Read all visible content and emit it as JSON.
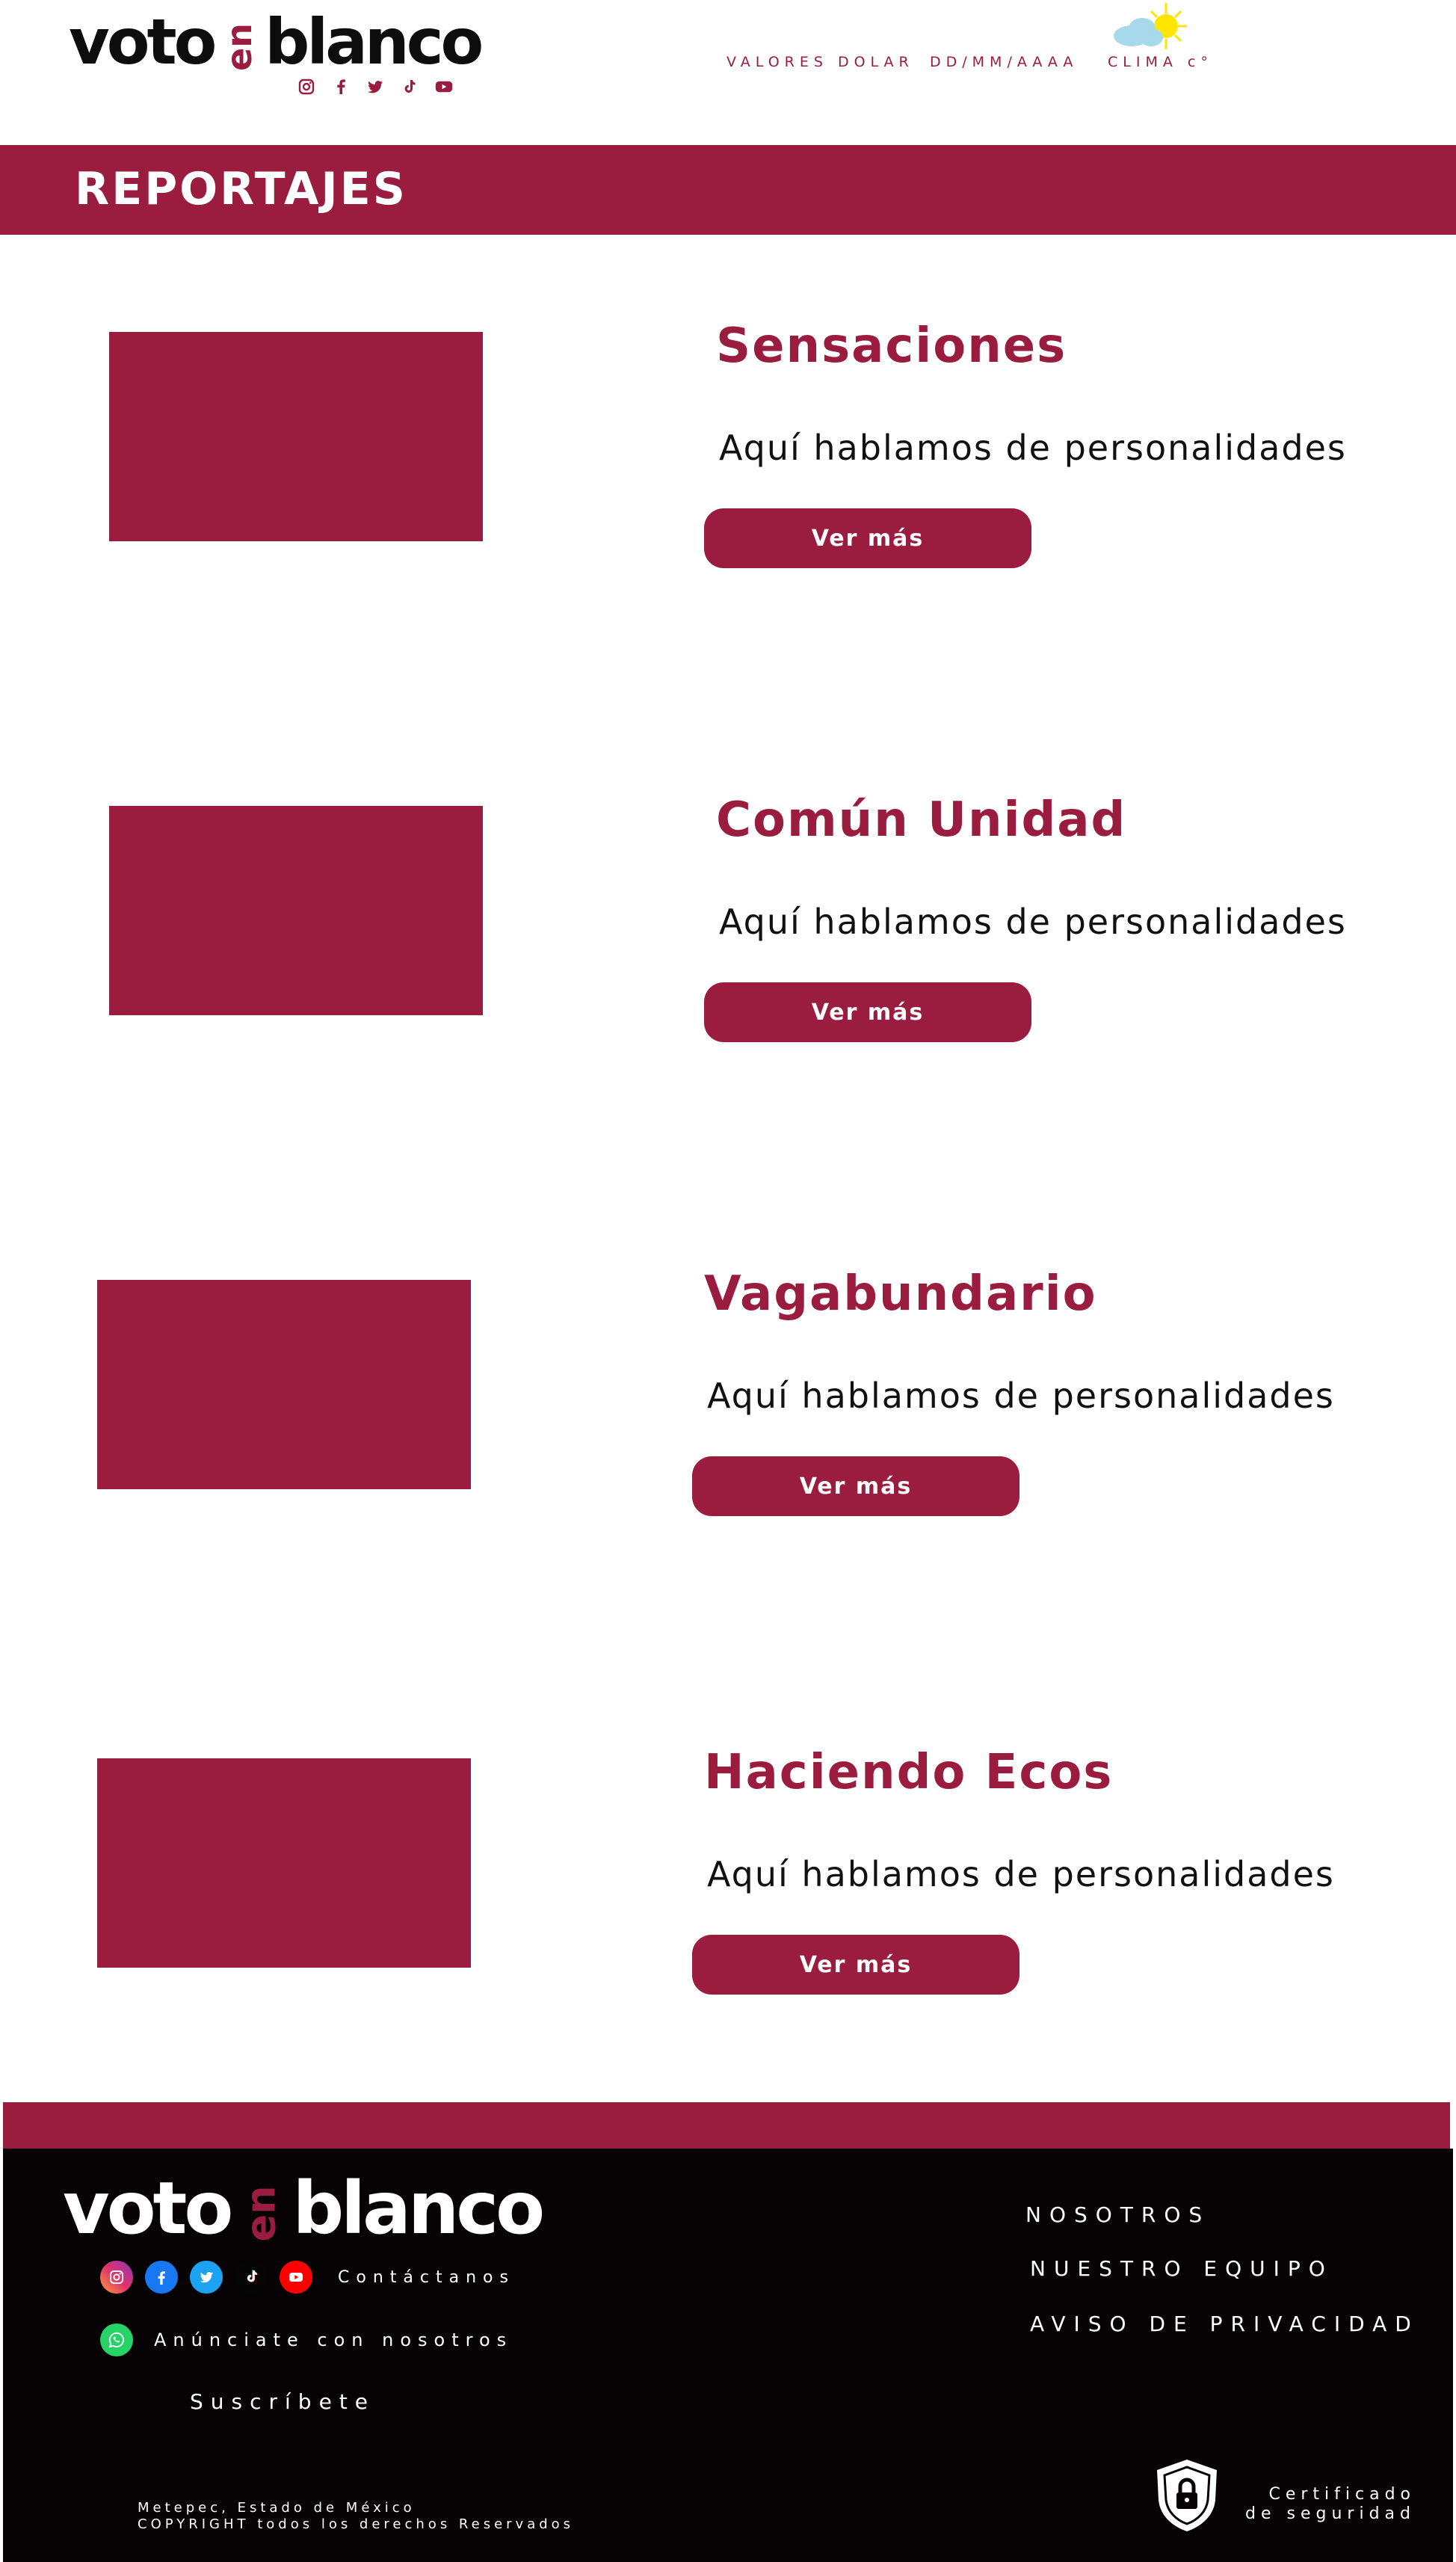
{
  "header": {
    "logo": {
      "part1": "voto",
      "part2": "en",
      "part3": "blanco"
    },
    "social_icons": [
      "instagram-icon",
      "facebook-icon",
      "twitter-icon",
      "tiktok-icon",
      "youtube-icon"
    ],
    "dolar": "VALORES DOLAR",
    "fecha": "DD/MM/AAAA",
    "clima": "CLIMA c°"
  },
  "section": {
    "title": "REPORTAJES"
  },
  "articles": [
    {
      "title": "Sensaciones",
      "description": "Aquí hablamos de personalidades",
      "button": "Ver más"
    },
    {
      "title": "Común Unidad",
      "description": "Aquí hablamos de personalidades",
      "button": "Ver más"
    },
    {
      "title": "Vagabundario",
      "description": "Aquí hablamos de personalidades",
      "button": "Ver más"
    },
    {
      "title": "Haciendo Ecos",
      "description": "Aquí hablamos de personalidades",
      "button": "Ver más"
    }
  ],
  "footer": {
    "logo": {
      "part1": "voto",
      "part2": "en",
      "part3": "blanco"
    },
    "contact": "Contáctanos",
    "anunciate": "Anúnciate con nosotros",
    "suscribete": "Suscríbete",
    "nav": [
      "NOSOTROS",
      "NUESTRO EQUIPO",
      "AVISO DE PRIVACIDAD"
    ],
    "legal_line1": "Metepec, Estado de México",
    "legal_line2": "COPYRIGHT todos los derechos Reservados",
    "cert_line1": "Certificado",
    "cert_line2": "de seguridad"
  },
  "colors": {
    "brand": "#9a1d3f",
    "footer_bg": "#070203",
    "text": "#111111"
  }
}
